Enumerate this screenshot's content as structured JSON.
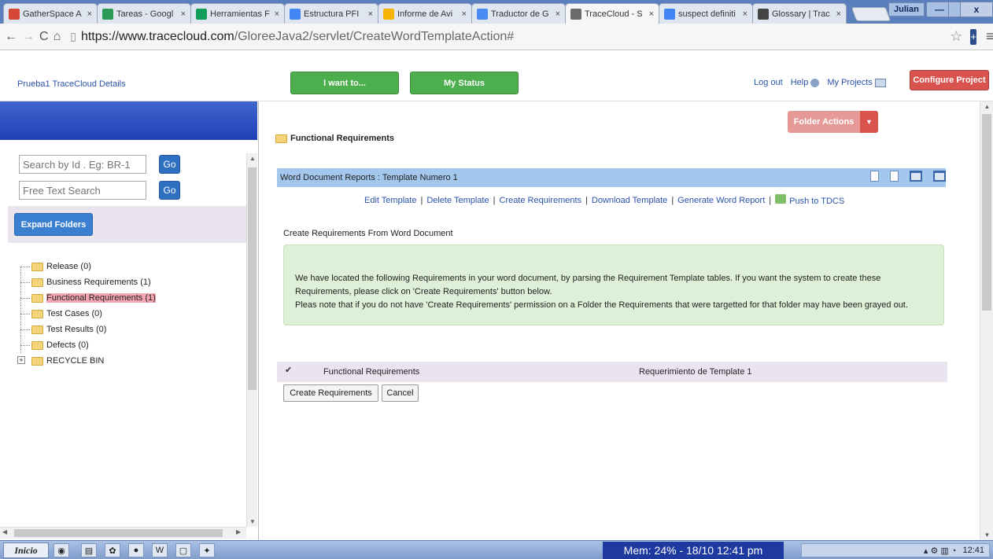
{
  "browser": {
    "tabs": [
      {
        "title": "GatherSpace A",
        "favicon_color": "#d44638",
        "active": false
      },
      {
        "title": "Tareas - Googl",
        "favicon_color": "#2b9b57",
        "active": false
      },
      {
        "title": "Herramientas F",
        "favicon_color": "#0f9d58",
        "active": false
      },
      {
        "title": "Estructura PFI",
        "favicon_color": "#4285f4",
        "active": false
      },
      {
        "title": "Informe de Avi",
        "favicon_color": "#f4b400",
        "active": false
      },
      {
        "title": "Traductor de G",
        "favicon_color": "#4a8af4",
        "active": false
      },
      {
        "title": "TraceCloud - S",
        "favicon_color": "#6b6b6b",
        "active": true
      },
      {
        "title": "suspect definiti",
        "favicon_color": "#4285f4",
        "active": false
      },
      {
        "title": "Glossary | Trac",
        "favicon_color": "#444444",
        "active": false
      }
    ],
    "user": "Julian",
    "window_buttons": {
      "minimize": "—",
      "maximize": "▫",
      "close": "x"
    },
    "url_host": "https://www.tracecloud.com",
    "url_path": "/GloreeJava2/servlet/CreateWordTemplateAction#"
  },
  "header": {
    "breadcrumb": "Prueba1 TraceCloud Details",
    "i_want_to": "I want to...",
    "my_status": "My Status",
    "logout": "Log out",
    "help": "Help",
    "my_projects": "My Projects",
    "configure_project": "Configure Project"
  },
  "sidebar": {
    "search_id_placeholder": "Search by Id . Eg: BR-1",
    "free_text_placeholder": "Free Text Search",
    "go_label": "Go",
    "expand_folders": "Expand Folders",
    "tree": [
      {
        "label": "Release (0)",
        "selected": false
      },
      {
        "label": "Business Requirements (1)",
        "selected": false
      },
      {
        "label": "Functional Requirements (1)",
        "selected": true
      },
      {
        "label": "Test Cases (0)",
        "selected": false
      },
      {
        "label": "Test Results (0)",
        "selected": false
      },
      {
        "label": "Defects (0)",
        "selected": false
      }
    ],
    "recycle_bin": "RECYCLE BIN"
  },
  "main": {
    "folder_actions": "Folder Actions",
    "folder_title": "Functional Requirements",
    "report_bar_title": "Word Document Reports : Template Numero 1",
    "links": [
      "Edit Template",
      "Delete Template",
      "Create Requirements",
      "Download Template",
      "Generate Word Report"
    ],
    "push_link": "Push to TDCS",
    "subtitle": "Create Requirements From Word Document",
    "info_line1": "We have located the following Requirements in your word document, by parsing the Requirement Template tables. If you want the system to create these",
    "info_line2": "Requirements, please click on 'Create Requirements' button below.",
    "info_line3": "Pleas note that if you do not have 'Create Requirements' permission on a Folder the Requirements that were targetted for that folder may have been grayed out.",
    "req_folder": "Functional Requirements",
    "req_name": "Requerimiento de Template 1",
    "req_checked": true,
    "create_button": "Create Requirements",
    "cancel_button": "Cancel"
  },
  "taskbar": {
    "start": "Inicio",
    "mem": "Mem: 24% - 18/10  12:41 pm",
    "clock": "12:41"
  },
  "colors": {
    "green_button": "#4cae4c",
    "red_button": "#d9534f",
    "link_blue": "#2a52a8",
    "report_bar": "#a4c7ee",
    "info_bg": "#dff0d8"
  }
}
